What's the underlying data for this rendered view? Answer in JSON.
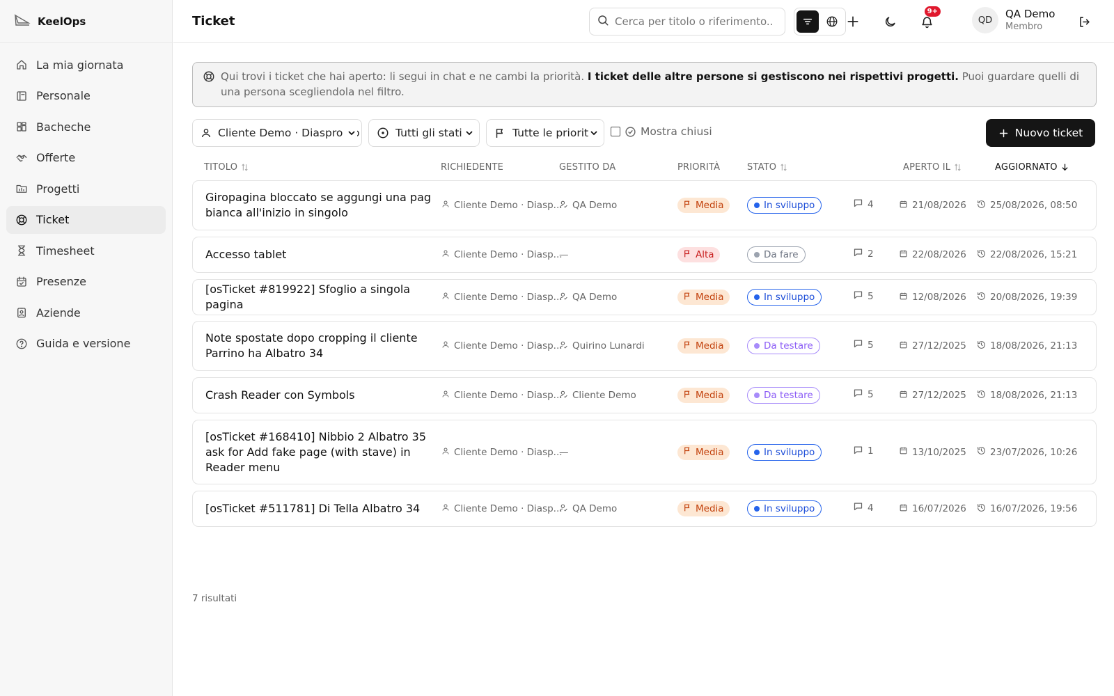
{
  "app": {
    "name": "KeelOps"
  },
  "sidebar": {
    "items": [
      {
        "label": "La mia giornata",
        "icon": "home-icon"
      },
      {
        "label": "Personale",
        "icon": "book-icon"
      },
      {
        "label": "Bacheche",
        "icon": "grid-icon"
      },
      {
        "label": "Offerte",
        "icon": "handshake-icon"
      },
      {
        "label": "Progetti",
        "icon": "folder-chart-icon"
      },
      {
        "label": "Ticket",
        "icon": "lifebuoy-icon",
        "active": true
      },
      {
        "label": "Timesheet",
        "icon": "hourglass-icon"
      },
      {
        "label": "Presenze",
        "icon": "calendar-check-icon"
      },
      {
        "label": "Aziende",
        "icon": "id-badge-icon"
      },
      {
        "label": "Guida e versione",
        "icon": "help-circle-icon"
      }
    ]
  },
  "header": {
    "title": "Ticket",
    "search_placeholder": "Cerca per titolo o riferimento...",
    "notifications_badge": "9+",
    "user": {
      "initials": "QD",
      "name": "QA Demo",
      "role": "Membro"
    }
  },
  "notice": {
    "text_before": "Qui trovi i ticket che hai aperto: li segui in chat e ne cambi la priorità.",
    "text_bold": "I ticket delle altre persone si gestiscono nei rispettivi progetti.",
    "text_after": "Puoi guardare quelli di una persona scegliendola nel filtro."
  },
  "filters": {
    "person": "Cliente Demo · Diaspro So",
    "status": "Tutti gli stati",
    "priority": "Tutte le priorità",
    "show_closed": "Mostra chiusi",
    "new_button": "Nuovo ticket"
  },
  "table": {
    "columns": {
      "title": "TITOLO",
      "requester": "RICHIEDENTE",
      "managed_by": "GESTITO DA",
      "priority": "PRIORITÀ",
      "status": "STATO",
      "opened": "APERTO IL",
      "updated": "AGGIORNATO"
    },
    "rows": [
      {
        "title": "Giropagina bloccato se aggungi una pag bianca all'inizio in singolo",
        "requester": "Cliente Demo · Diasp...",
        "managed_by": "QA Demo",
        "priority": "Media",
        "status": "In sviluppo",
        "comments": "4",
        "opened": "21/08/2026",
        "updated": "25/08/2026, 08:50"
      },
      {
        "title": "Accesso tablet",
        "requester": "Cliente Demo · Diasp...",
        "managed_by": "—",
        "priority": "Alta",
        "status": "Da fare",
        "comments": "2",
        "opened": "22/08/2026",
        "updated": "22/08/2026, 15:21"
      },
      {
        "title": "[osTicket #819922] Sfoglio a singola pagina",
        "requester": "Cliente Demo · Diasp...",
        "managed_by": "QA Demo",
        "priority": "Media",
        "status": "In sviluppo",
        "comments": "5",
        "opened": "12/08/2026",
        "updated": "20/08/2026, 19:39"
      },
      {
        "title": "Note spostate dopo cropping il cliente Parrino ha Albatro 34",
        "requester": "Cliente Demo · Diasp...",
        "managed_by": "Quirino Lunardi",
        "priority": "Media",
        "status": "Da testare",
        "comments": "5",
        "opened": "27/12/2025",
        "updated": "18/08/2026, 21:13"
      },
      {
        "title": "Crash Reader con Symbols",
        "requester": "Cliente Demo · Diasp...",
        "managed_by": "Cliente Demo",
        "priority": "Media",
        "status": "Da testare",
        "comments": "5",
        "opened": "27/12/2025",
        "updated": "18/08/2026, 21:13"
      },
      {
        "title": "[osTicket #168410] Nibbio 2 Albatro 35 ask for Add fake page (with stave) in Reader menu",
        "requester": "Cliente Demo · Diasp...",
        "managed_by": "—",
        "priority": "Media",
        "status": "In sviluppo",
        "comments": "1",
        "opened": "13/10/2025",
        "updated": "23/07/2026, 10:26"
      },
      {
        "title": "[osTicket #511781] Di Tella Albatro 34",
        "requester": "Cliente Demo · Diasp...",
        "managed_by": "QA Demo",
        "priority": "Media",
        "status": "In sviluppo",
        "comments": "4",
        "opened": "16/07/2026",
        "updated": "16/07/2026, 19:56"
      }
    ],
    "results": "7 risultati"
  },
  "colors": {
    "priority": {
      "Media": {
        "bg": "#fde7d3",
        "fg": "#c2410c"
      },
      "Alta": {
        "bg": "#fde0e0",
        "fg": "#c81e1e"
      }
    },
    "status": {
      "In sviluppo": {
        "border": "#2563eb",
        "fg": "#1d4ed8",
        "dot": "#2563eb"
      },
      "Da fare": {
        "border": "#9ca3af",
        "fg": "#6b7280",
        "dot": "#9ca3af"
      },
      "Da testare": {
        "border": "#a78bfa",
        "fg": "#8b5cf6",
        "dot": "#a78bfa"
      }
    }
  }
}
